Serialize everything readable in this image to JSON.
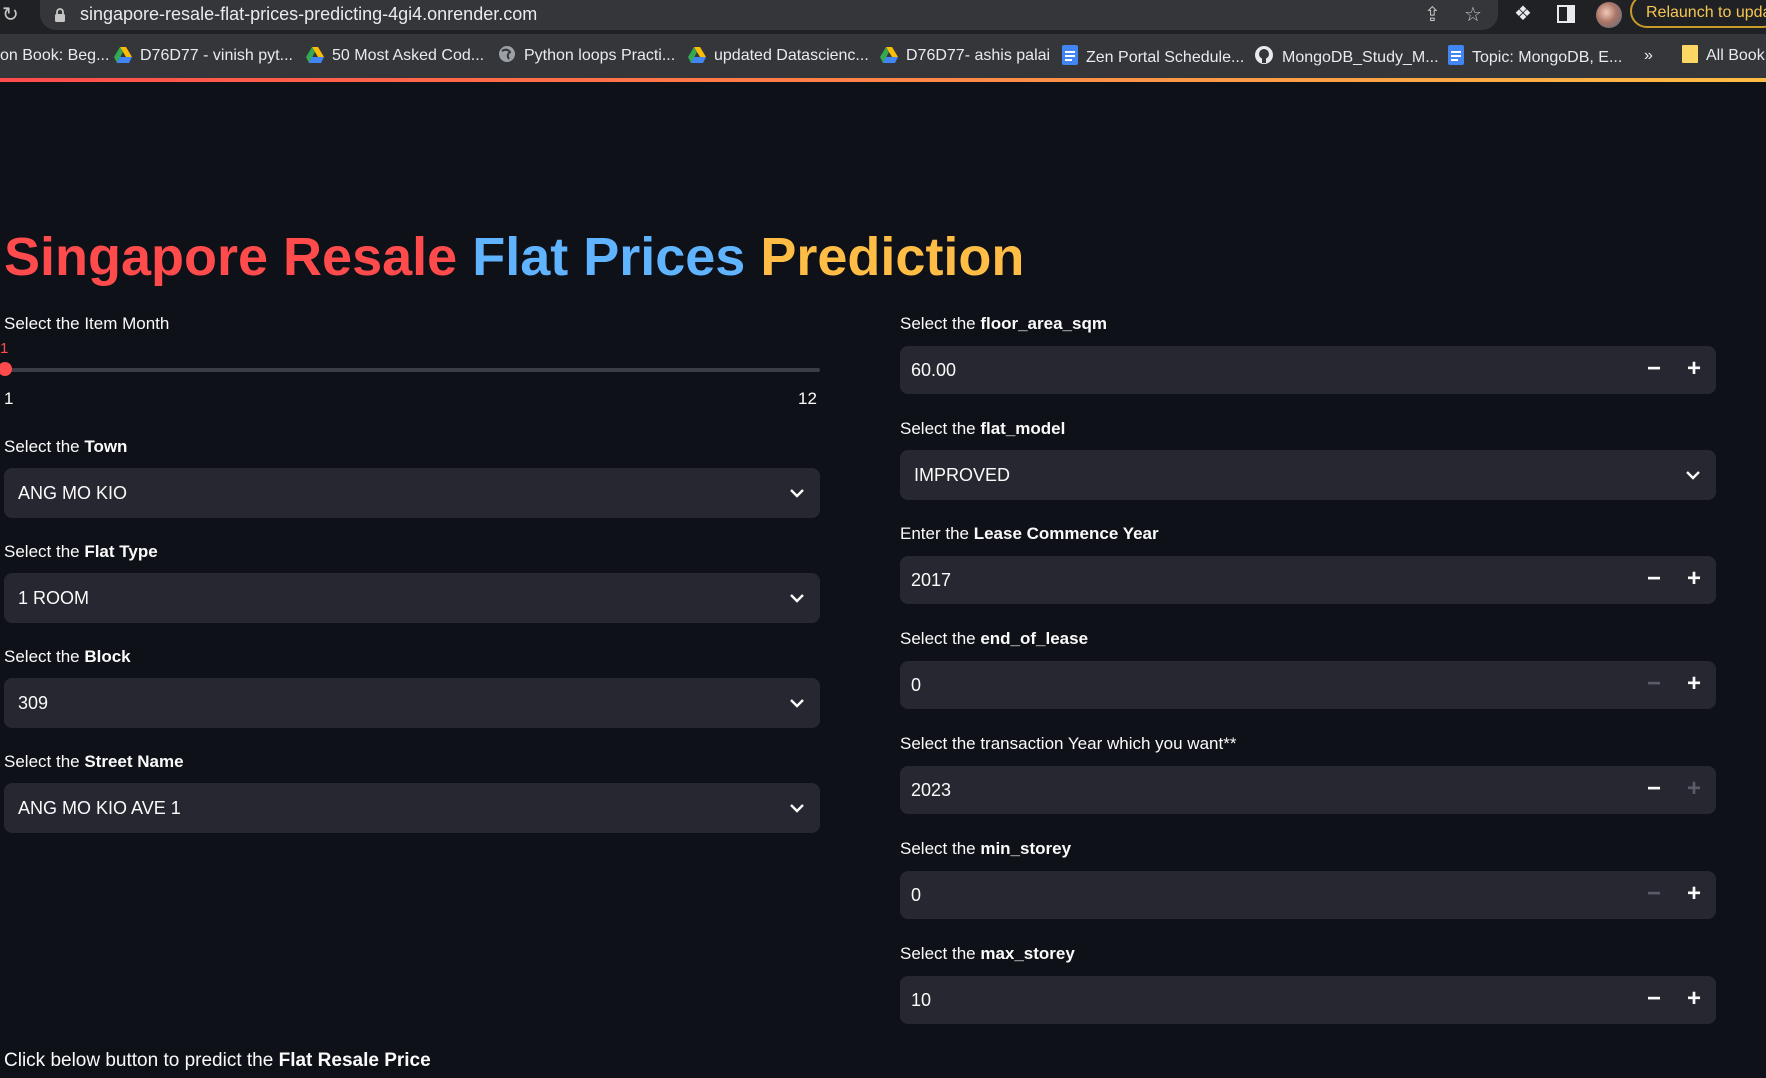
{
  "browser": {
    "url": "singapore-resale-flat-prices-predicting-4gi4.onrender.com",
    "relaunch_label": "Relaunch to updat",
    "bookmarks": [
      {
        "label": "on Book: Beg...",
        "icon": "none"
      },
      {
        "label": "D76D77 - vinish pyt...",
        "icon": "drive-icon"
      },
      {
        "label": "50 Most Asked Cod...",
        "icon": "drive-icon"
      },
      {
        "label": "Python loops Practi...",
        "icon": "globe-icon"
      },
      {
        "label": "updated Datascienc...",
        "icon": "drive-icon"
      },
      {
        "label": "D76D77- ashis palai",
        "icon": "drive-icon"
      },
      {
        "label": "Zen Portal Schedule...",
        "icon": "docs-icon"
      },
      {
        "label": "MongoDB_Study_M...",
        "icon": "github-icon"
      },
      {
        "label": "Topic: MongoDB, E...",
        "icon": "docs-icon"
      }
    ],
    "more_label": "»",
    "all_bookmarks_label": "All Book"
  },
  "app": {
    "title": {
      "part1": "Singapore Resale",
      "part2": "Flat Prices",
      "part3": "Prediction"
    },
    "colors": {
      "accent": "#ff4b4b",
      "blue": "#60b4ff",
      "orange": "#ffbd45",
      "background": "#0e1117",
      "widget": "#262730"
    },
    "month_slider": {
      "label": "Select the Item Month",
      "value": "1",
      "min": "1",
      "max": "12",
      "fraction": 0
    },
    "town": {
      "label_prefix": "Select the ",
      "label_bold": "Town",
      "value": "ANG MO KIO"
    },
    "flat_type": {
      "label_prefix": "Select the ",
      "label_bold": "Flat Type",
      "value": "1 ROOM"
    },
    "block": {
      "label_prefix": "Select the ",
      "label_bold": "Block",
      "value": "309"
    },
    "street": {
      "label_prefix": "Select the ",
      "label_bold": "Street Name",
      "value": "ANG MO KIO AVE 1"
    },
    "floor_area": {
      "label_prefix": "Select the ",
      "label_bold": "floor_area_sqm",
      "value": "60.00"
    },
    "flat_model": {
      "label_prefix": "Select the ",
      "label_bold": "flat_model",
      "value": "IMPROVED"
    },
    "lease_year": {
      "label_prefix": "Enter the ",
      "label_bold": "Lease Commence Year",
      "value": "2017"
    },
    "end_of_lease": {
      "label_prefix": "Select the ",
      "label_bold": "end_of_lease",
      "value": "0"
    },
    "transaction_year": {
      "label": "Select the transaction Year which you want**",
      "value": "2023"
    },
    "min_storey": {
      "label_prefix": "Select the ",
      "label_bold": "min_storey",
      "value": "0"
    },
    "max_storey": {
      "label_prefix": "Select the ",
      "label_bold": "max_storey",
      "value": "10"
    },
    "predict_hint": {
      "prefix": "Click below button to predict the ",
      "bold": "Flat Resale Price"
    },
    "minus_symbol": "−",
    "plus_symbol": "+"
  }
}
